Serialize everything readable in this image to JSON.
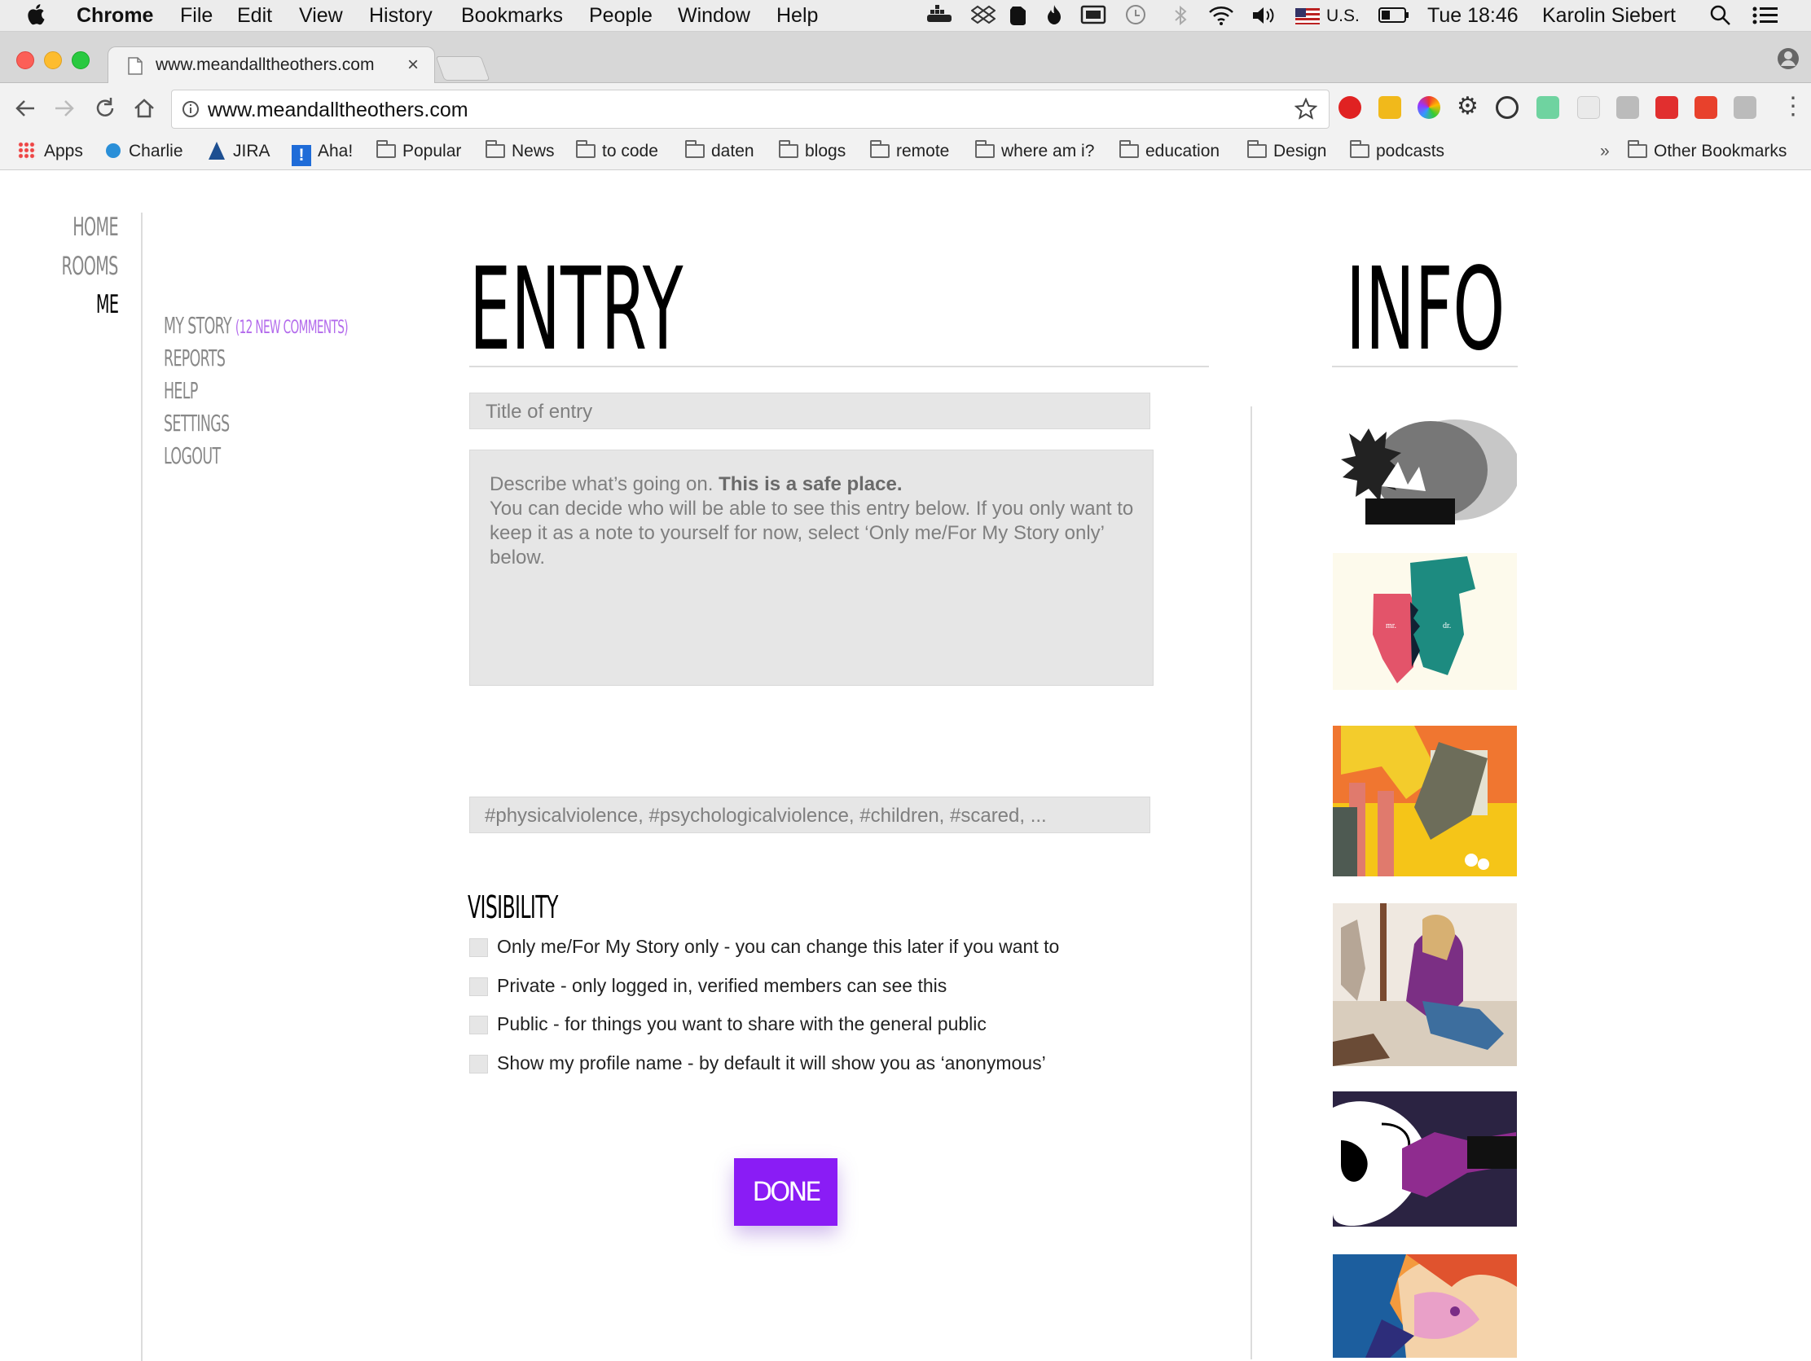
{
  "menubar": {
    "apple": "",
    "app": "Chrome",
    "items": [
      "File",
      "Edit",
      "View",
      "History",
      "Bookmarks",
      "People",
      "Window",
      "Help"
    ],
    "input_source": "U.S.",
    "clock": "Tue 18:46",
    "user": "Karolin Siebert"
  },
  "browser": {
    "tab_title": "www.meandalltheothers.com",
    "tab_close": "×",
    "url": "www.meandalltheothers.com",
    "bookmarks": [
      "Apps",
      "Charlie",
      "JIRA",
      "Aha!",
      "Popular",
      "News",
      "to code",
      "daten",
      "blogs",
      "remote",
      "where am i?",
      "education",
      "Design",
      "podcasts"
    ],
    "bookmarks_overflow": "»",
    "other_bookmarks": "Other Bookmarks"
  },
  "site": {
    "nav": [
      "HOME",
      "ROOMS",
      "ME"
    ],
    "subnav": {
      "my_story": "MY STORY",
      "new_comments": "(12 NEW COMMENTS)",
      "reports": "REPORTS",
      "help": "HELP",
      "settings": "SETTINGS",
      "logout": "LOGOUT"
    },
    "entry_heading": "ENTRY",
    "info_heading": "INFO",
    "title_placeholder": "Title of entry",
    "description": {
      "lead": "Describe what’s going on. ",
      "bold": "This is a safe place.",
      "rest": "You can decide who will be able to see this entry below. If you only want to keep it as a note to yourself for now, select ‘Only me/For My Story only’ below."
    },
    "tags_placeholder": "#physicalviolence, #psychologicalviolence, #children, #scared, ...",
    "visibility_heading": "VISIBILITY",
    "visibility_options": [
      "Only me/For My Story only - you can change this later if you want to",
      "Private - only logged in, verified members can see this",
      "Public - for things you want to share with the general public",
      "Show my profile name - by default it will show you as ‘anonymous’"
    ],
    "done_button": "DONE",
    "accent_color": "#8a1cf5"
  }
}
